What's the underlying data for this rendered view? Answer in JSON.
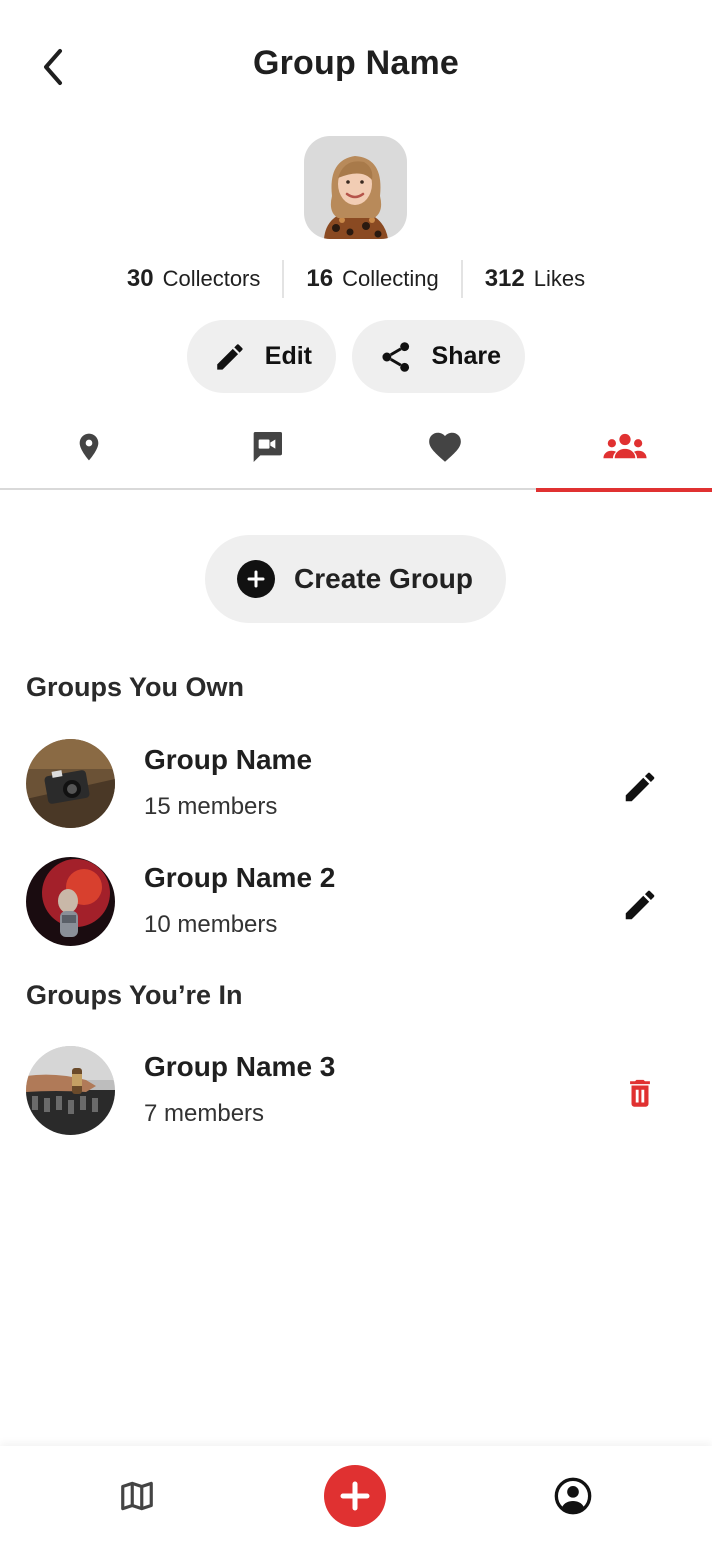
{
  "header": {
    "title": "Group Name",
    "back_icon": "chevron-left-icon"
  },
  "stats": [
    {
      "value": "30",
      "label": "Collectors"
    },
    {
      "value": "16",
      "label": "Collecting"
    },
    {
      "value": "312",
      "label": "Likes"
    }
  ],
  "actions": {
    "edit_label": "Edit",
    "share_label": "Share"
  },
  "tabs": [
    {
      "icon": "location-pin-icon",
      "active": false
    },
    {
      "icon": "video-icon",
      "active": false
    },
    {
      "icon": "heart-icon",
      "active": false
    },
    {
      "icon": "groups-icon",
      "active": true
    }
  ],
  "create_group_label": "Create Group",
  "sections": {
    "own_title": "Groups You Own",
    "in_title": "Groups You’re In"
  },
  "groups_own": [
    {
      "name": "Group Name",
      "members": "15 members",
      "action": "pencil-icon"
    },
    {
      "name": "Group Name 2",
      "members": "10 members",
      "action": "pencil-icon"
    }
  ],
  "groups_in": [
    {
      "name": "Group Name 3",
      "members": "7 members",
      "action": "trash-icon"
    }
  ],
  "bottom_nav": [
    {
      "icon": "map-icon"
    },
    {
      "icon": "plus-icon"
    },
    {
      "icon": "account-circle-icon"
    }
  ],
  "colors": {
    "accent": "#e03131",
    "pill_bg": "#efefef",
    "text": "#1f1f1f"
  }
}
